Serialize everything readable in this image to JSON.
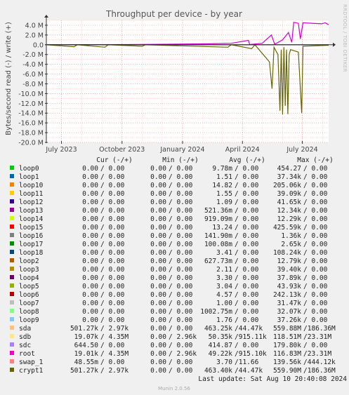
{
  "chart_data": {
    "type": "line",
    "title": "Throughput per device - by year",
    "ylabel": "Bytes/second read (-) / write (+)",
    "ylim": [
      -20.0,
      5.0
    ],
    "y_ticks": [
      {
        "v": 4,
        "label": "4.0 M"
      },
      {
        "v": 2,
        "label": "2.0 M"
      },
      {
        "v": 0,
        "label": "0.0"
      },
      {
        "v": -2,
        "label": "-2.0 M"
      },
      {
        "v": -4,
        "label": "-4.0 M"
      },
      {
        "v": -6,
        "label": "-6.0 M"
      },
      {
        "v": -8,
        "label": "-8.0 M"
      },
      {
        "v": -10,
        "label": "-10.0 M"
      },
      {
        "v": -12,
        "label": "-12.0 M"
      },
      {
        "v": -14,
        "label": "-14.0 M"
      },
      {
        "v": -16,
        "label": "-16.0 M"
      },
      {
        "v": -18,
        "label": "-18.0 M"
      },
      {
        "v": -20,
        "label": "-20.0 M"
      }
    ],
    "x_range": [
      "2023-06-08",
      "2024-08-10"
    ],
    "x_ticks": [
      {
        "date": "2023-07-01",
        "label": "July 2023"
      },
      {
        "date": "2023-10-01",
        "label": "October 2023"
      },
      {
        "date": "2024-01-01",
        "label": "January 2024"
      },
      {
        "date": "2024-04-01",
        "label": "April 2024"
      },
      {
        "date": "2024-07-01",
        "label": "July 2024"
      }
    ],
    "grid": true,
    "series": [
      {
        "name": "root",
        "color": "#cc00cc",
        "points": [
          [
            "2023-06-08",
            0.02
          ],
          [
            "2023-10-10",
            0.05
          ],
          [
            "2023-12-15",
            0.12
          ],
          [
            "2024-02-10",
            0.2
          ],
          [
            "2024-03-15",
            0.3
          ],
          [
            "2024-04-10",
            0.9
          ],
          [
            "2024-04-12",
            0.05
          ],
          [
            "2024-05-01",
            0.3
          ],
          [
            "2024-05-15",
            2.0
          ],
          [
            "2024-05-20",
            0.1
          ],
          [
            "2024-06-01",
            1.0
          ],
          [
            "2024-06-10",
            2.5
          ],
          [
            "2024-06-15",
            0.5
          ],
          [
            "2024-06-18",
            4.6
          ],
          [
            "2024-06-25",
            4.4
          ],
          [
            "2024-06-28",
            1.2
          ],
          [
            "2024-07-02",
            4.5
          ],
          [
            "2024-07-30",
            4.3
          ],
          [
            "2024-08-05",
            4.5
          ],
          [
            "2024-08-10",
            4.1
          ]
        ]
      },
      {
        "name": "crypt1",
        "color": "#666600",
        "points": [
          [
            "2023-06-08",
            0
          ],
          [
            "2023-07-20",
            -0.4
          ],
          [
            "2023-07-25",
            0
          ],
          [
            "2023-09-05",
            -0.5
          ],
          [
            "2023-09-10",
            0
          ],
          [
            "2023-11-01",
            -0.3
          ],
          [
            "2023-11-05",
            0
          ],
          [
            "2024-03-10",
            -0.5
          ],
          [
            "2024-03-15",
            0
          ],
          [
            "2024-04-15",
            -0.8
          ],
          [
            "2024-04-20",
            0
          ],
          [
            "2024-05-12",
            -3.5
          ],
          [
            "2024-05-16",
            -9.0
          ],
          [
            "2024-05-19",
            -0.5
          ],
          [
            "2024-05-25",
            -2.0
          ],
          [
            "2024-05-28",
            -13.5
          ],
          [
            "2024-05-30",
            -1.0
          ],
          [
            "2024-06-01",
            -14.3
          ],
          [
            "2024-06-03",
            -0.5
          ],
          [
            "2024-06-05",
            -12.5
          ],
          [
            "2024-06-07",
            -1.0
          ],
          [
            "2024-06-09",
            -14.2
          ],
          [
            "2024-06-11",
            -2.0
          ],
          [
            "2024-06-13",
            -1.0
          ],
          [
            "2024-06-25",
            -1.5
          ],
          [
            "2024-06-30",
            -14.0
          ],
          [
            "2024-07-02",
            -0.3
          ],
          [
            "2024-08-10",
            -0.1
          ]
        ]
      },
      {
        "name": "sda",
        "color": "#1a1a1a",
        "points": [
          [
            "2023-06-08",
            0
          ],
          [
            "2024-08-10",
            0
          ]
        ]
      }
    ],
    "legend": {
      "columns": [
        "Cur (-/+)",
        "Min (-/+)",
        "Avg (-/+)",
        "Max (-/+)"
      ],
      "rows": [
        {
          "name": "loop0",
          "color": "#00cc00",
          "cur": "0.00 /  0.00",
          "min": "0.00 /  0.00",
          "avg": "9.78m/  0.00",
          "max": "454.27 /  0.00"
        },
        {
          "name": "loop1",
          "color": "#0066b3",
          "cur": "0.00 /  0.00",
          "min": "0.00 /  0.00",
          "avg": "1.51 /  0.00",
          "max": "37.34k/  0.00"
        },
        {
          "name": "loop10",
          "color": "#ff8000",
          "cur": "0.00 /  0.00",
          "min": "0.00 /  0.00",
          "avg": "14.82 /  0.00",
          "max": "205.06k/  0.00"
        },
        {
          "name": "loop11",
          "color": "#ffcc00",
          "cur": "0.00 /  0.00",
          "min": "0.00 /  0.00",
          "avg": "1.55 /  0.00",
          "max": "39.09k/  0.00"
        },
        {
          "name": "loop12",
          "color": "#330099",
          "cur": "0.00 /  0.00",
          "min": "0.00 /  0.00",
          "avg": "1.09 /  0.00",
          "max": "41.65k/  0.00"
        },
        {
          "name": "loop13",
          "color": "#990099",
          "cur": "0.00 /  0.00",
          "min": "0.00 /  0.00",
          "avg": "521.36m/  0.00",
          "max": "12.34k/  0.00"
        },
        {
          "name": "loop14",
          "color": "#ccff00",
          "cur": "0.00 /  0.00",
          "min": "0.00 /  0.00",
          "avg": "919.09m/  0.00",
          "max": "12.29k/  0.00"
        },
        {
          "name": "loop15",
          "color": "#ff0000",
          "cur": "0.00 /  0.00",
          "min": "0.00 /  0.00",
          "avg": "13.24 /  0.00",
          "max": "425.59k/  0.00"
        },
        {
          "name": "loop16",
          "color": "#808080",
          "cur": "0.00 /  0.00",
          "min": "0.00 /  0.00",
          "avg": "141.90m/  0.00",
          "max": "1.36k/  0.00"
        },
        {
          "name": "loop17",
          "color": "#008f00",
          "cur": "0.00 /  0.00",
          "min": "0.00 /  0.00",
          "avg": "100.08m/  0.00",
          "max": "2.65k/  0.00"
        },
        {
          "name": "loop18",
          "color": "#00487d",
          "cur": "0.00 /  0.00",
          "min": "0.00 /  0.00",
          "avg": "3.41 /  0.00",
          "max": "108.24k/  0.00"
        },
        {
          "name": "loop2",
          "color": "#b35a00",
          "cur": "0.00 /  0.00",
          "min": "0.00 /  0.00",
          "avg": "627.73m/  0.00",
          "max": "12.79k/  0.00"
        },
        {
          "name": "loop3",
          "color": "#b38f00",
          "cur": "0.00 /  0.00",
          "min": "0.00 /  0.00",
          "avg": "2.11 /  0.00",
          "max": "39.40k/  0.00"
        },
        {
          "name": "loop4",
          "color": "#6b006b",
          "cur": "0.00 /  0.00",
          "min": "0.00 /  0.00",
          "avg": "3.30 /  0.00",
          "max": "37.89k/  0.00"
        },
        {
          "name": "loop5",
          "color": "#8fb300",
          "cur": "0.00 /  0.00",
          "min": "0.00 /  0.00",
          "avg": "3.04 /  0.00",
          "max": "43.93k/  0.00"
        },
        {
          "name": "loop6",
          "color": "#b30000",
          "cur": "0.00 /  0.00",
          "min": "0.00 /  0.00",
          "avg": "4.57 /  0.00",
          "max": "242.13k/  0.00"
        },
        {
          "name": "loop7",
          "color": "#bebebe",
          "cur": "0.00 /  0.00",
          "min": "0.00 /  0.00",
          "avg": "1.00 /  0.00",
          "max": "31.47k/  0.00"
        },
        {
          "name": "loop8",
          "color": "#80ff80",
          "cur": "0.00 /  0.00",
          "min": "0.00 /  0.00",
          "avg": "1002.75m/  0.00",
          "max": "32.07k/  0.00"
        },
        {
          "name": "loop9",
          "color": "#80c9ff",
          "cur": "0.00 /  0.00",
          "min": "0.00 /  0.00",
          "avg": "1.76 /  0.00",
          "max": "37.26k/  0.00"
        },
        {
          "name": "sda",
          "color": "#ffc080",
          "cur": "501.27k/  2.97k",
          "min": "0.00 /  0.00",
          "avg": "463.25k/ 44.47k",
          "max": "559.88M/186.36M"
        },
        {
          "name": "sdb",
          "color": "#ffe680",
          "cur": "19.07k/  4.35M",
          "min": "0.00 /  2.96k",
          "avg": "50.35k/915.11k",
          "max": "118.51M/ 23.31M"
        },
        {
          "name": "sdc",
          "color": "#aa80ff",
          "cur": "644.50 /  0.00",
          "min": "0.00 /  0.00",
          "avg": "414.87 /  0.00",
          "max": "179.80k/  0.00"
        },
        {
          "name": "root",
          "color": "#ee00cc",
          "cur": "19.01k/  4.35M",
          "min": "0.00 /  2.96k",
          "avg": "49.22k/915.10k",
          "max": "116.83M/ 23.31M"
        },
        {
          "name": "swap_1",
          "color": "#ff8080",
          "cur": "48.55m/  0.00",
          "min": "0.00 /  0.00",
          "avg": "3.70 / 11.66",
          "max": "139.56k/444.12k"
        },
        {
          "name": "crypt1",
          "color": "#666600",
          "cur": "501.27k/  2.97k",
          "min": "0.00 /  0.00",
          "avg": "463.40k/ 44.47k",
          "max": "559.90M/186.36M"
        }
      ]
    }
  },
  "last_update": "Last update: Sat Aug 10 20:40:08 2024",
  "footer": "Munin 2.0.56",
  "side_label": "RRDTOOL / TOBI OETIKER"
}
